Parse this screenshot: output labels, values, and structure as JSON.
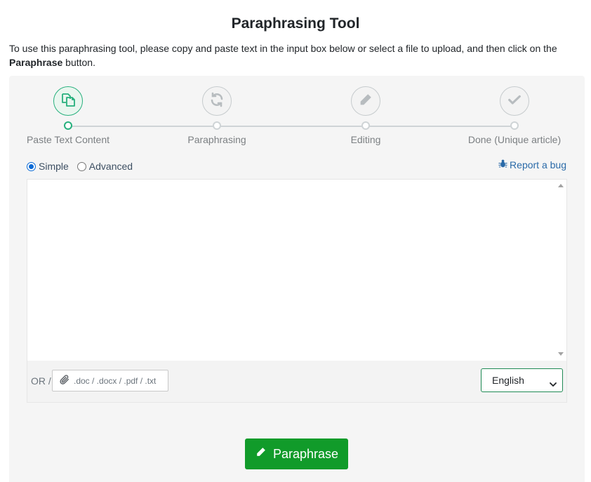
{
  "page": {
    "title": "Paraphrasing Tool",
    "intro_before": "To use this paraphrasing tool, please copy and paste text in the input box below or select a file to upload, and then click on the ",
    "intro_bold": "Paraphrase",
    "intro_after": " button."
  },
  "steps": [
    {
      "label": "Paste Text Content",
      "icon": "copy-icon",
      "active": true
    },
    {
      "label": "Paraphrasing",
      "icon": "refresh-icon",
      "active": false
    },
    {
      "label": "Editing",
      "icon": "pencil-icon",
      "active": false
    },
    {
      "label": "Done (Unique article)",
      "icon": "check-icon",
      "active": false
    }
  ],
  "mode": {
    "simple_label": "Simple",
    "advanced_label": "Advanced",
    "selected": "Simple"
  },
  "report_bug": {
    "label": "Report a bug",
    "icon": "bug-icon"
  },
  "input": {
    "value": "",
    "placeholder": ""
  },
  "upload": {
    "or_label": "OR /",
    "file_types": ".doc / .docx / .pdf / .txt",
    "icon": "paperclip-icon"
  },
  "language": {
    "selected": "English"
  },
  "action": {
    "label": "Paraphrase",
    "icon": "pencil-icon"
  },
  "colors": {
    "accent_green": "#119b2a",
    "active_step": "#27b07d",
    "link": "#2a6aa8"
  }
}
